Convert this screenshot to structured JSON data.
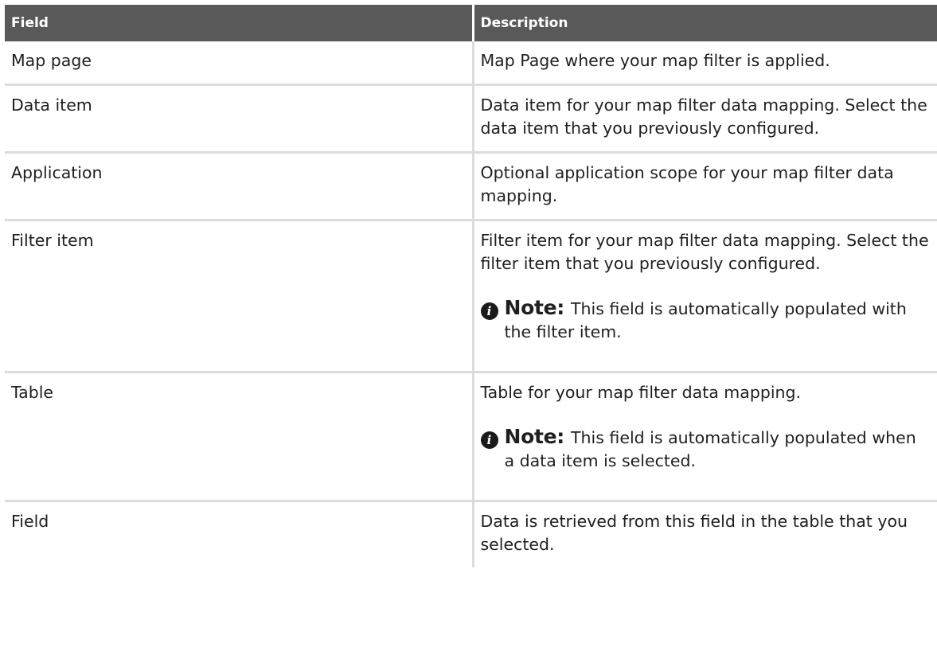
{
  "table": {
    "headers": {
      "field": "Field",
      "description": "Description"
    },
    "rows": [
      {
        "field": "Map page",
        "description": "Map Page where your map filter is applied."
      },
      {
        "field": "Data item",
        "description": "Data item for your map filter data mapping. Select the data item that you previously configured."
      },
      {
        "field": "Application",
        "description": "Optional application scope for your map filter data mapping."
      },
      {
        "field": "Filter item",
        "description": "Filter item for your map filter data mapping. Select the filter item that you previously configured.",
        "note_label": "Note:",
        "note_text": "This field is automatically populated with the filter item."
      },
      {
        "field": "Table",
        "description": "Table for your map filter data mapping.",
        "note_label": "Note:",
        "note_text": "This field is automatically populated when a data item is selected."
      },
      {
        "field": "Field",
        "description": "Data is retrieved from this field in the table that you selected."
      }
    ]
  },
  "icons": {
    "note": "info-icon",
    "note_glyph": "i"
  }
}
